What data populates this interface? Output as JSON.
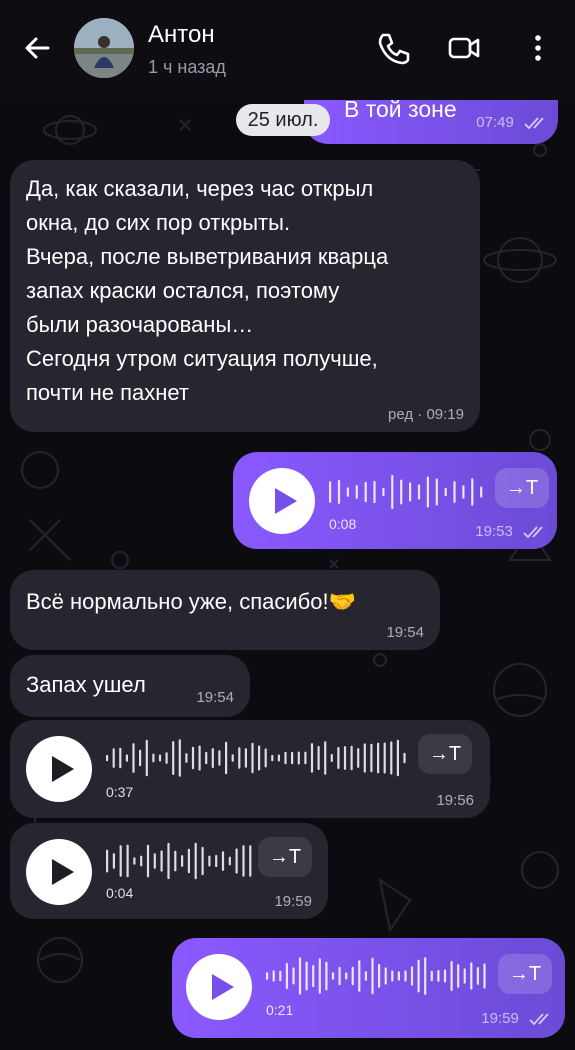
{
  "header": {
    "name": "Антон",
    "status": "1 ч назад",
    "icons": [
      "back-arrow-icon",
      "phone-icon",
      "video-call-icon",
      "more-vertical-icon"
    ]
  },
  "date_chip": "25 июл.",
  "messages": {
    "m0": {
      "text": "В той зоне",
      "time": "07:49"
    },
    "m1": {
      "lines": [
        "Да, как сказали, через час открыл",
        "окна, до сих пор открыты.",
        "Вчера, после выветривания кварца",
        "запах краски остался, поэтому",
        "были разочарованы…",
        "Сегодня утром ситуация получше,",
        "почти не пахнет"
      ],
      "meta": "ред · 09:19"
    },
    "v1": {
      "duration": "0:08",
      "time": "19:53",
      "transcribe": "→T"
    },
    "m2": {
      "text": "Всё нормально уже, спасибо!🤝",
      "time": "19:54"
    },
    "m3": {
      "text": "Запах ушел",
      "time": "19:54"
    },
    "v2": {
      "duration": "0:37",
      "time": "19:56",
      "transcribe": "→T"
    },
    "v3": {
      "duration": "0:04",
      "time": "19:59",
      "transcribe": "→T"
    },
    "v4": {
      "duration": "0:21",
      "time": "19:59",
      "transcribe": "→T"
    }
  },
  "colors": {
    "background": "#0c0c10",
    "incoming_bubble": "#25262f",
    "outgoing_start": "#8a59ff",
    "outgoing_end": "#6b4bd6"
  }
}
